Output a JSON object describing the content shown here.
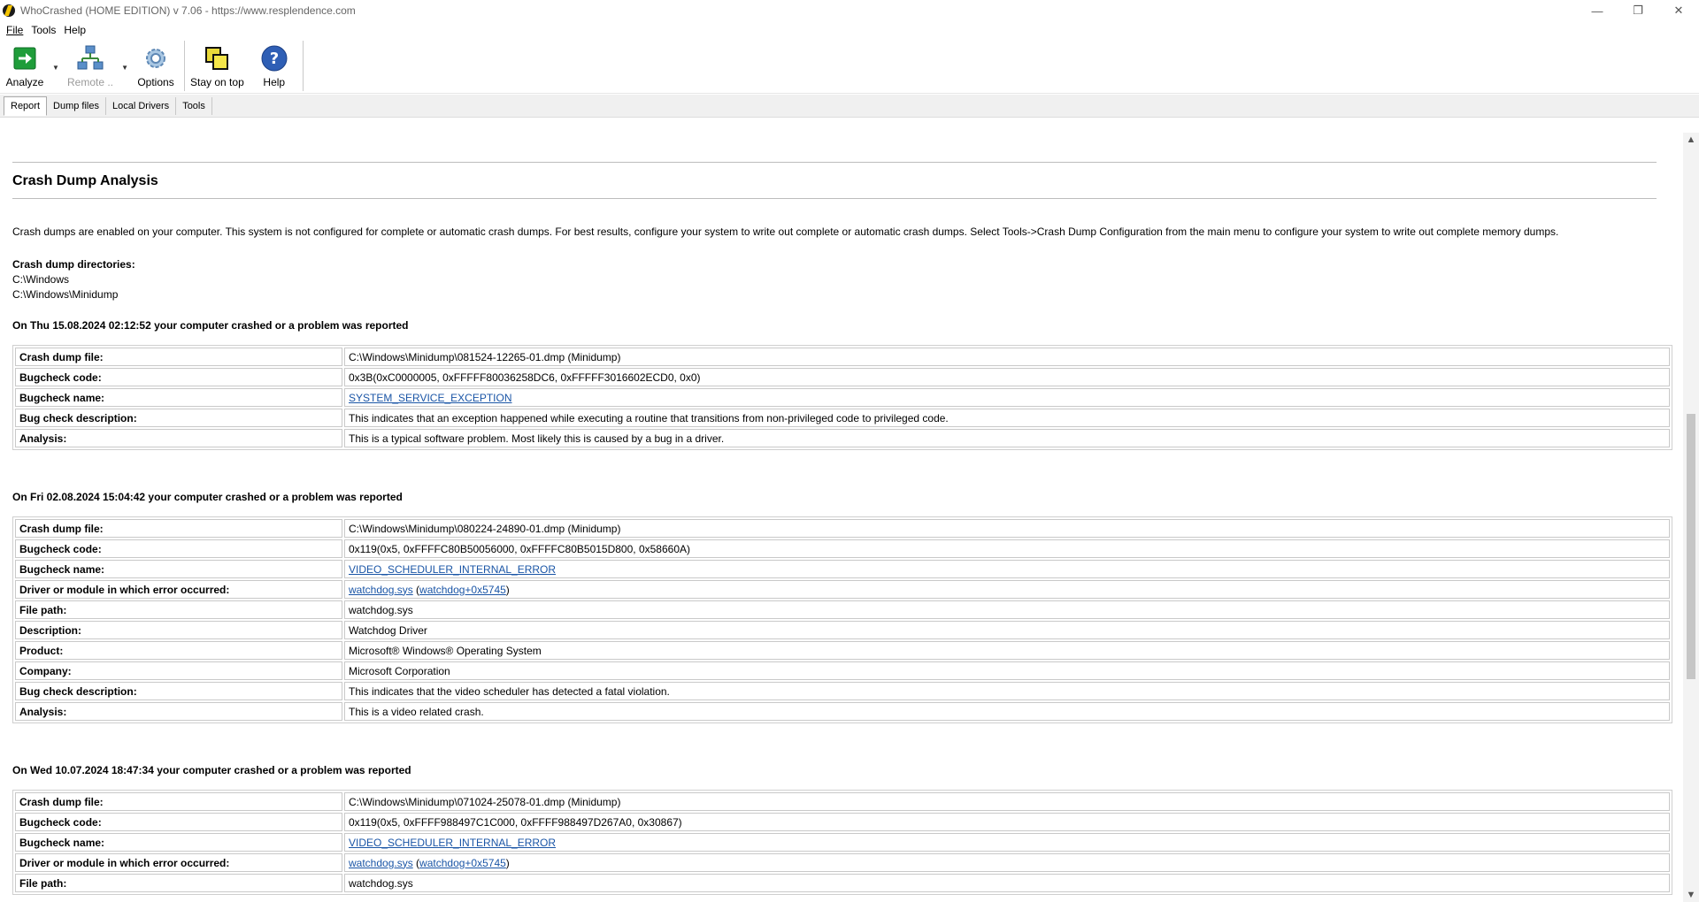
{
  "window": {
    "title": "WhoCrashed  (HOME EDITION)  v 7.06  -   https://www.resplendence.com",
    "minimize_icon": "minimize-icon",
    "restore_icon": "restore-icon",
    "close_icon": "close-icon"
  },
  "menu": {
    "items": [
      {
        "label": "File"
      },
      {
        "label": "Tools"
      },
      {
        "label": "Help"
      }
    ]
  },
  "toolbar": {
    "analyze_label": "Analyze",
    "remote_label": "Remote ..",
    "options_label": "Options",
    "stay_on_top_label": "Stay on top",
    "help_label": "Help"
  },
  "tabs": [
    {
      "label": "Report",
      "active": true
    },
    {
      "label": "Dump files"
    },
    {
      "label": "Local Drivers"
    },
    {
      "label": "Tools"
    }
  ],
  "report": {
    "title": "Crash Dump Analysis",
    "intro": "Crash dumps are enabled on your computer. This system is not configured for complete or automatic crash dumps. For best results, configure your system to write out complete or automatic crash dumps. Select Tools->Crash Dump Configuration from the main menu to configure your system to write out complete memory dumps.",
    "dirs_label": "Crash dump directories:",
    "dirs": [
      "C:\\Windows",
      "C:\\Windows\\Minidump"
    ],
    "crashes": [
      {
        "heading": "On Thu 15.08.2024 02:12:52 your computer crashed or a problem was reported",
        "rows": [
          {
            "k": "Crash dump file:",
            "v": "C:\\Windows\\Minidump\\081524-12265-01.dmp (Minidump)"
          },
          {
            "k": "Bugcheck code:",
            "v": "0x3B(0xC0000005, 0xFFFFF80036258DC6, 0xFFFFF3016602ECD0, 0x0)"
          },
          {
            "k": "Bugcheck name:",
            "v": "SYSTEM_SERVICE_EXCEPTION"
          },
          {
            "k": "Bug check description:",
            "v": "This indicates that an exception happened while executing a routine that transitions from non-privileged code to privileged code."
          },
          {
            "k": "Analysis:",
            "v": "This is a typical software problem. Most likely this is caused by a bug in a driver."
          }
        ]
      },
      {
        "heading": "On Fri 02.08.2024 15:04:42 your computer crashed or a problem was reported",
        "rows": [
          {
            "k": "Crash dump file:",
            "v": "C:\\Windows\\Minidump\\080224-24890-01.dmp (Minidump)"
          },
          {
            "k": "Bugcheck code:",
            "v": "0x119(0x5, 0xFFFFC80B50056000, 0xFFFFC80B5015D800, 0x58660A)"
          },
          {
            "k": "Bugcheck name:",
            "v": "VIDEO_SCHEDULER_INTERNAL_ERROR"
          },
          {
            "k": "Driver or module in which error occurred:",
            "v": "watchdog.sys",
            "v2": "watchdog+0x5745"
          },
          {
            "k": "File path:",
            "v": "watchdog.sys"
          },
          {
            "k": "Description:",
            "v": "Watchdog Driver"
          },
          {
            "k": "Product:",
            "v": "Microsoft® Windows® Operating System"
          },
          {
            "k": "Company:",
            "v": "Microsoft Corporation"
          },
          {
            "k": "Bug check description:",
            "v": "This indicates that the video scheduler has detected a fatal violation."
          },
          {
            "k": "Analysis:",
            "v": "This is a video related crash."
          }
        ]
      },
      {
        "heading": "On Wed 10.07.2024 18:47:34 your computer crashed or a problem was reported",
        "rows": [
          {
            "k": "Crash dump file:",
            "v": "C:\\Windows\\Minidump\\071024-25078-01.dmp (Minidump)"
          },
          {
            "k": "Bugcheck code:",
            "v": "0x119(0x5, 0xFFFF988497C1C000, 0xFFFF988497D267A0, 0x30867)"
          },
          {
            "k": "Bugcheck name:",
            "v": "VIDEO_SCHEDULER_INTERNAL_ERROR"
          },
          {
            "k": "Driver or module in which error occurred:",
            "v": "watchdog.sys",
            "v2": "watchdog+0x5745"
          },
          {
            "k": "File path:",
            "v": "watchdog.sys"
          }
        ]
      }
    ]
  },
  "colors": {
    "link": "#1a55a6",
    "border": "#c9c9c9"
  }
}
